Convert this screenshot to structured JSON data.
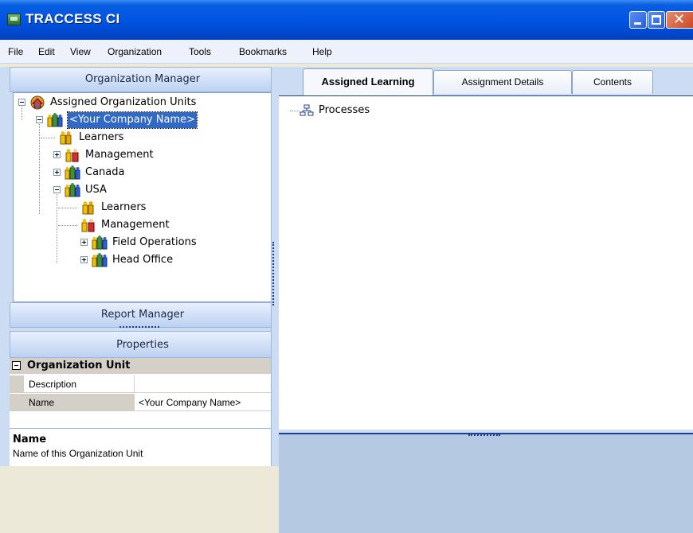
{
  "window": {
    "title": "TRACCESS CI",
    "controls": [
      "minimize",
      "maximize",
      "close"
    ]
  },
  "menu": [
    "File",
    "Edit",
    "View",
    "Organization",
    "Tools",
    "Bookmarks",
    "Help"
  ],
  "left": {
    "org_manager_title": "Organization Manager",
    "tree": [
      {
        "label": "Assigned Organization Units",
        "level": 0,
        "expander": "minus",
        "icon": "home-org-icon"
      },
      {
        "label": "<Your Company Name>",
        "level": 1,
        "expander": "minus",
        "icon": "org-unit-icon",
        "selected": true
      },
      {
        "label": "Learners",
        "level": 2,
        "expander": "none",
        "icon": "learners-icon"
      },
      {
        "label": "Management",
        "level": 2,
        "expander": "plus",
        "icon": "management-icon"
      },
      {
        "label": "Canada",
        "level": 2,
        "expander": "plus",
        "icon": "org-unit-icon"
      },
      {
        "label": "USA",
        "level": 2,
        "expander": "minus",
        "icon": "org-unit-icon"
      },
      {
        "label": "Learners",
        "level": 3,
        "expander": "none",
        "icon": "learners-icon"
      },
      {
        "label": "Management",
        "level": 3,
        "expander": "none",
        "icon": "management-icon"
      },
      {
        "label": "Field Operations",
        "level": 3,
        "expander": "plus",
        "icon": "org-unit-icon"
      },
      {
        "label": "Head Office",
        "level": 3,
        "expander": "plus",
        "icon": "org-unit-icon"
      }
    ],
    "report_manager_title": "Report Manager",
    "properties_title": "Properties",
    "properties": {
      "category": "Organization Unit",
      "rows": [
        {
          "key": "Description",
          "value": ""
        },
        {
          "key": "Name",
          "value": "<Your Company Name>"
        }
      ],
      "help_title": "Name",
      "help_text": "Name of this Organization Unit"
    }
  },
  "right": {
    "tabs": [
      "Assigned Learning",
      "Assignment Details",
      "Contents"
    ],
    "active_tab": "Assigned Learning",
    "content_items": [
      {
        "label": "Processes",
        "icon": "process-hierarchy-icon"
      }
    ]
  },
  "colors": {
    "titlebar": "#0054e3",
    "selection": "#3169c6",
    "panel": "#ccdcf2"
  }
}
